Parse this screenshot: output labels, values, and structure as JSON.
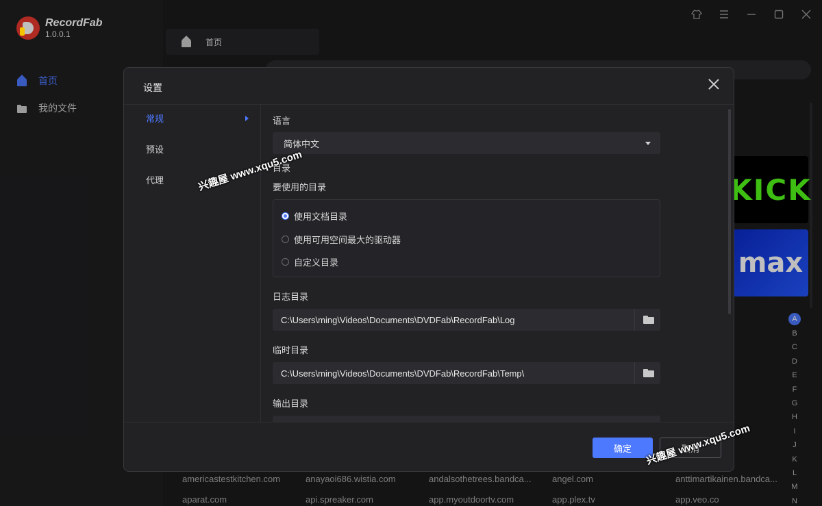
{
  "app": {
    "name": "RecordFab",
    "version": "1.0.0.1"
  },
  "sidebar": {
    "items": [
      {
        "label": "首页",
        "icon": "home-icon",
        "active": true
      },
      {
        "label": "我的文件",
        "icon": "folder-icon",
        "active": false
      }
    ]
  },
  "main": {
    "home_tab": "首页",
    "alphabet": [
      "A",
      "B",
      "C",
      "D",
      "E",
      "F",
      "G",
      "H",
      "I",
      "J",
      "K",
      "L",
      "M",
      "N"
    ],
    "banners": [
      "KICK",
      "max"
    ],
    "sites": [
      [
        "americastestkitchen.com",
        "anayaoi686.wistia.com",
        "andalsothetrees.bandca...",
        "angel.com",
        "anttimartikainen.bandca..."
      ],
      [
        "aparat.com",
        "api.spreaker.com",
        "app.myoutdoortv.com",
        "app.plex.tv",
        "app.veo.co"
      ]
    ]
  },
  "modal": {
    "title": "设置",
    "nav": [
      {
        "label": "常规",
        "active": true
      },
      {
        "label": "预设",
        "active": false
      },
      {
        "label": "代理",
        "active": false
      }
    ],
    "language_label": "语言",
    "language_value": "简体中文",
    "dir_section_label": "目录",
    "dir_use_label": "要使用的目录",
    "dir_options": [
      {
        "label": "使用文档目录",
        "selected": true
      },
      {
        "label": "使用可用空间最大的驱动器",
        "selected": false
      },
      {
        "label": "自定义目录",
        "selected": false
      }
    ],
    "log_label": "日志目录",
    "log_path": "C:\\Users\\ming\\Videos\\Documents\\DVDFab\\RecordFab\\Log",
    "temp_label": "临时目录",
    "temp_path": "C:\\Users\\ming\\Videos\\Documents\\DVDFab\\RecordFab\\Temp\\",
    "output_label": "输出目录",
    "ok_label": "确定",
    "cancel_label": "取消"
  },
  "watermark": "兴趣屋 www.xqu5.com",
  "colors": {
    "accent": "#4d79ff",
    "background": "#1b1b1d",
    "modal": "#222225"
  }
}
